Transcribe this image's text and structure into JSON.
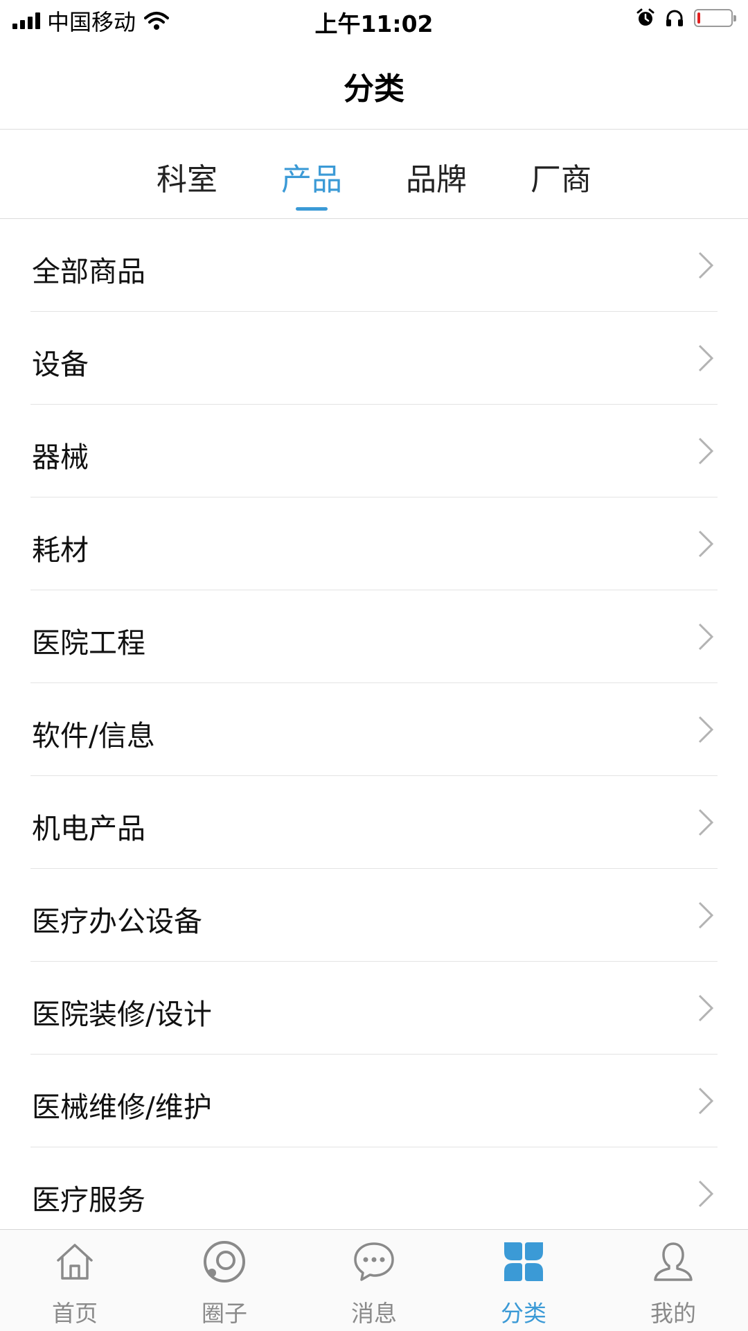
{
  "status_bar": {
    "carrier": "中国移动",
    "time": "上午11:02",
    "battery_level": 0.08,
    "icons": [
      "signal-icon",
      "wifi-icon",
      "alarm-icon",
      "headphones-icon",
      "battery-icon"
    ]
  },
  "nav": {
    "title": "分类"
  },
  "tabs": [
    {
      "label": "科室",
      "active": false
    },
    {
      "label": "产品",
      "active": true
    },
    {
      "label": "品牌",
      "active": false
    },
    {
      "label": "厂商",
      "active": false
    }
  ],
  "list": {
    "items": [
      {
        "label": "全部商品"
      },
      {
        "label": "设备"
      },
      {
        "label": "器械"
      },
      {
        "label": "耗材"
      },
      {
        "label": "医院工程"
      },
      {
        "label": "软件/信息"
      },
      {
        "label": "机电产品"
      },
      {
        "label": "医疗办公设备"
      },
      {
        "label": "医院装修/设计"
      },
      {
        "label": "医械维修/维护"
      },
      {
        "label": "医疗服务"
      }
    ]
  },
  "tab_bar": {
    "items": [
      {
        "label": "首页",
        "icon": "home-icon",
        "active": false
      },
      {
        "label": "圈子",
        "icon": "circle-icon",
        "active": false
      },
      {
        "label": "消息",
        "icon": "message-icon",
        "active": false
      },
      {
        "label": "分类",
        "icon": "category-icon",
        "active": true
      },
      {
        "label": "我的",
        "icon": "user-icon",
        "active": false
      }
    ]
  },
  "colors": {
    "accent": "#3b9ad6",
    "inactive": "#8a8a8a",
    "battery_low": "#e02020"
  }
}
